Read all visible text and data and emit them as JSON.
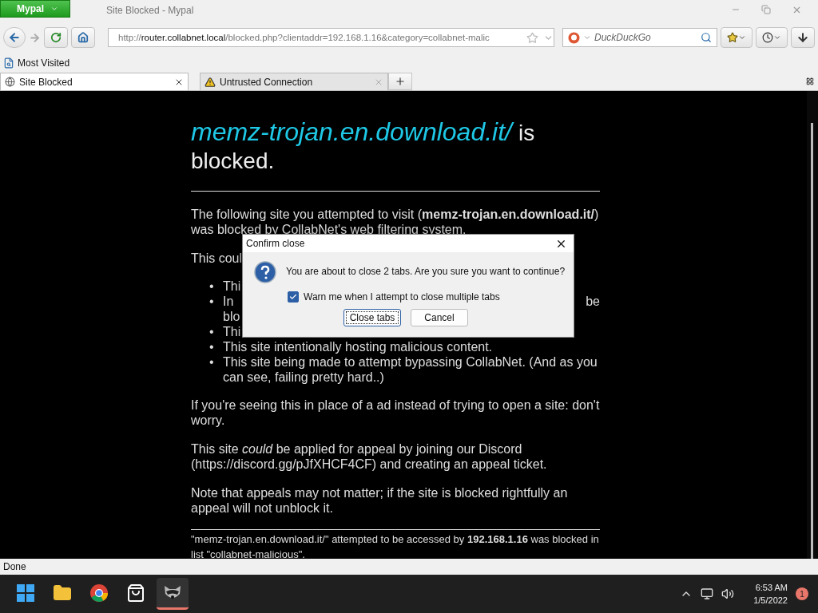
{
  "window": {
    "app_button": "Mypal",
    "title": "Site Blocked - Mypal"
  },
  "navigation": {
    "url": "http://**router.collabnet.local**/blocked.php?clientaddr=192.168.1.16&category=collabnet-malic",
    "search_placeholder": "DuckDuckGo"
  },
  "bookmarks": [
    "Most Visited"
  ],
  "tabs": [
    {
      "label": "Site Blocked",
      "selected": true,
      "kind": "globe"
    },
    {
      "label": "Untrusted Connection",
      "selected": false,
      "kind": "warning"
    }
  ],
  "page": {
    "title_link": "memz-trojan.en.download.it/",
    "title_rest": "is blocked.",
    "intro": "The following site you attempted to visit (**memz-trojan.en.download.it/**) was blocked by CollabNet's web filtering system.",
    "covered_paragraph": "This coul",
    "bullets": [
      {
        "marker": "•",
        "lines": [
          {
            "left": "Thi"
          }
        ]
      },
      {
        "marker": "•",
        "lines": [
          {
            "left": "In",
            "right": "be"
          },
          {
            "left": "blo"
          }
        ]
      },
      {
        "marker": "•",
        "lines": [
          {
            "left": "Thi"
          }
        ]
      },
      {
        "marker": "•",
        "lines": [
          {
            "left": "This site intentionally hosting malicious content."
          }
        ]
      },
      {
        "marker": "•",
        "lines": [
          {
            "left": "This site being made to attempt bypassing CollabNet. (And as you can see, failing pretty hard..)"
          }
        ]
      }
    ],
    "paragraphs": [
      "If you're seeing this in place of a ad instead of trying to open a site: don't worry.",
      "This site *could* be applied for appeal by joining our Discord (https://discord.gg/pJfXHCF4CF) and creating an appeal ticket.",
      "Note that appeals may not matter; if the site is blocked rightfully an appeal will not unblock it."
    ],
    "footer": "\"memz-trojan.en.download.it/\" attempted to be accessed by **192.168.1.16** was blocked in list \"collabnet-malicious\"."
  },
  "dialog": {
    "title": "Confirm close",
    "message": "You are about to close 2 tabs. Are you sure you want to continue?",
    "checkbox": {
      "label": "Warn me when I attempt to close multiple tabs",
      "checked": true
    },
    "buttons": [
      {
        "label": "Close tabs",
        "focused": true
      },
      {
        "label": "Cancel",
        "focused": false
      }
    ]
  },
  "status_bar": "Done",
  "taskbar": {
    "apps": [
      {
        "kind": "start",
        "selected": false
      },
      {
        "kind": "explorer",
        "selected": false
      },
      {
        "kind": "chrome",
        "selected": false
      },
      {
        "kind": "store",
        "selected": false
      },
      {
        "kind": "raccoon",
        "selected": true
      }
    ],
    "time": "6:53 AM",
    "date": "1/5/2022",
    "notifications": "1"
  }
}
